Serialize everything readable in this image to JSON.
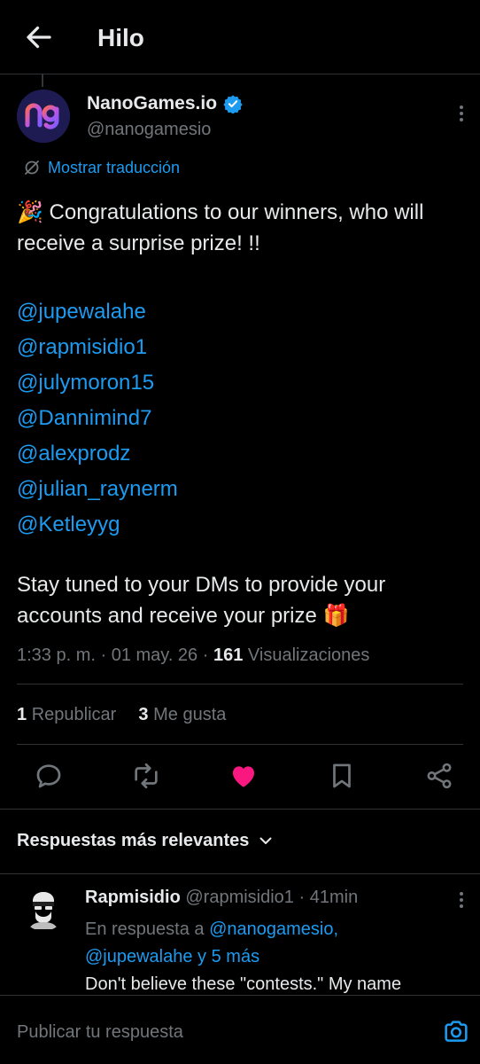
{
  "header": {
    "title": "Hilo"
  },
  "tweet": {
    "display_name": "NanoGames.io",
    "handle": "@nanogamesio",
    "translate_label": "Mostrar traducción",
    "text_intro": "🎉 Congratulations to our winners, who will receive a surprise prize! !!",
    "mentions": [
      "@jupewalahe",
      "@rapmisidio1",
      "@julymoron15",
      "@Dannimind7",
      "@alexprodz",
      "@julian_raynerm",
      "@Ketleyyg"
    ],
    "text_outro": "Stay tuned to your DMs to provide your accounts and receive your prize 🎁",
    "time": "1:33 p. m.",
    "date": "01 may. 26",
    "views_count": "161",
    "views_label": "Visualizaciones",
    "reposts_count": "1",
    "reposts_label": "Republicar",
    "likes_count": "3",
    "likes_label": "Me gusta",
    "liked": true,
    "colors": {
      "accent": "#1d9bf0",
      "like": "#f91880",
      "background": "#000000",
      "muted": "#71767b"
    }
  },
  "replies": {
    "sort_label": "Respuestas más relevantes",
    "items": [
      {
        "display_name": "Rapmisidio",
        "handle": "@rapmisidio1",
        "time": "41min",
        "context_prefix": "En respuesta a",
        "context_link1": "@nanogamesio,",
        "context_link2": "@jupewalahe y 5 más",
        "text": "Don't believe these \"contests.\" My name"
      }
    ]
  },
  "composer": {
    "placeholder": "Publicar tu respuesta"
  },
  "icons": {
    "back": "arrow-left-icon",
    "verified": "verified-badge-icon",
    "more": "more-vertical-icon",
    "translate": "translate-icon",
    "reply": "reply-icon",
    "repost": "repost-icon",
    "like": "heart-filled-icon",
    "bookmark": "bookmark-icon",
    "share": "share-icon",
    "chevron": "chevron-down-icon",
    "camera": "camera-icon"
  }
}
